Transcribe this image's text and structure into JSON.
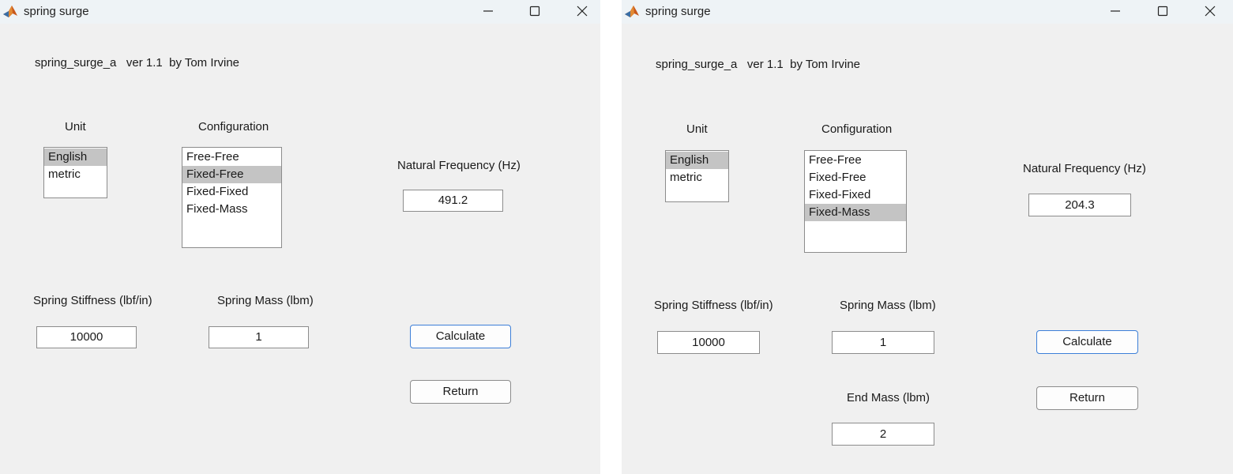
{
  "windows": [
    {
      "title": "spring surge",
      "header": "spring_surge_a   ver 1.1  by Tom Irvine",
      "unit": {
        "label": "Unit",
        "options": [
          "English",
          "metric"
        ],
        "selected": "English"
      },
      "configuration": {
        "label": "Configuration",
        "options": [
          "Free-Free",
          "Fixed-Free",
          "Fixed-Fixed",
          "Fixed-Mass"
        ],
        "selected": "Fixed-Free"
      },
      "natural_frequency": {
        "label": "Natural Frequency (Hz)",
        "value": "491.2"
      },
      "spring_stiffness": {
        "label": "Spring Stiffness (lbf/in)",
        "value": "10000"
      },
      "spring_mass": {
        "label": "Spring Mass (lbm)",
        "value": "1"
      },
      "calculate_label": "Calculate",
      "return_label": "Return"
    },
    {
      "title": "spring surge",
      "header": "spring_surge_a   ver 1.1  by Tom Irvine",
      "unit": {
        "label": "Unit",
        "options": [
          "English",
          "metric"
        ],
        "selected": "English"
      },
      "configuration": {
        "label": "Configuration",
        "options": [
          "Free-Free",
          "Fixed-Free",
          "Fixed-Fixed",
          "Fixed-Mass"
        ],
        "selected": "Fixed-Mass"
      },
      "natural_frequency": {
        "label": "Natural Frequency (Hz)",
        "value": "204.3"
      },
      "spring_stiffness": {
        "label": "Spring Stiffness (lbf/in)",
        "value": "10000"
      },
      "spring_mass": {
        "label": "Spring Mass (lbm)",
        "value": "1"
      },
      "end_mass": {
        "label": "End Mass (lbm)",
        "value": "2"
      },
      "calculate_label": "Calculate",
      "return_label": "Return"
    }
  ],
  "icons": {
    "app": "matlab-logo-icon",
    "minimize": "minimize-icon",
    "maximize": "maximize-icon",
    "close": "close-icon"
  },
  "colors": {
    "window_bg": "#f0f0f0",
    "titlebar_bg": "#eef3f6",
    "selection": "#c4c4c4",
    "primary_button_border": "#3d7fd8"
  }
}
